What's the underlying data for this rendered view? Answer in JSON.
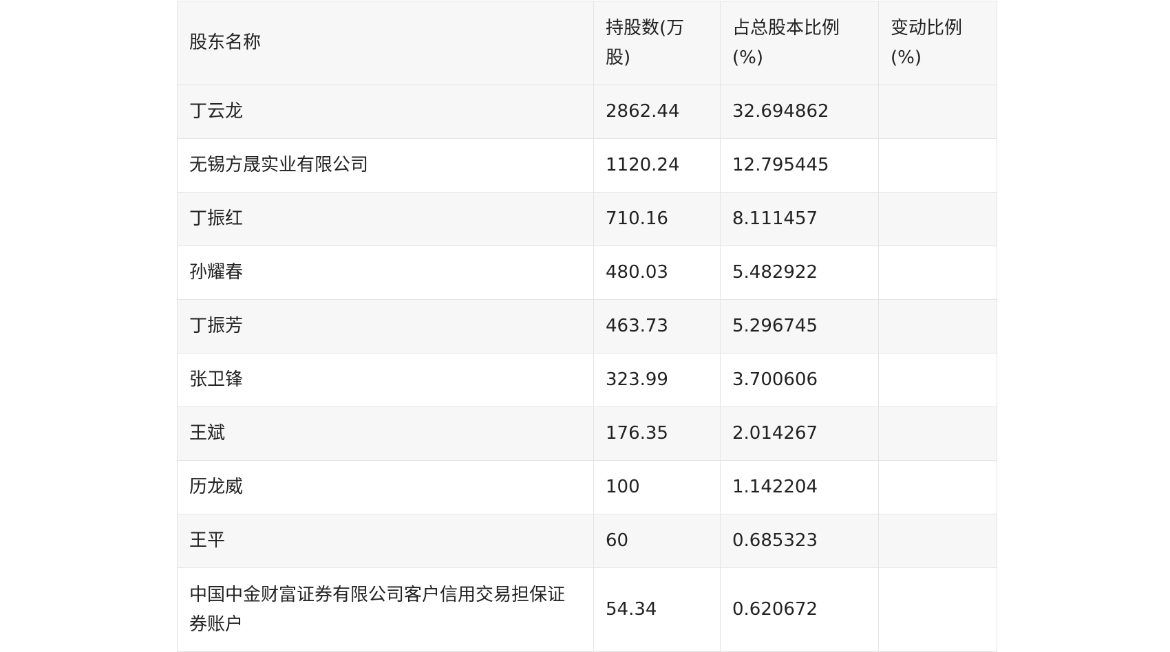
{
  "table": {
    "headers": [
      "股东名称",
      "持股数(万股)",
      "占总股本比例(%)",
      "变动比例(%)"
    ],
    "rows": [
      {
        "name": "丁云龙",
        "shares": "2862.44",
        "ratio": "32.694862",
        "change": ""
      },
      {
        "name": "无锡方晟实业有限公司",
        "shares": "1120.24",
        "ratio": "12.795445",
        "change": ""
      },
      {
        "name": "丁振红",
        "shares": "710.16",
        "ratio": "8.111457",
        "change": ""
      },
      {
        "name": "孙耀春",
        "shares": "480.03",
        "ratio": "5.482922",
        "change": ""
      },
      {
        "name": "丁振芳",
        "shares": "463.73",
        "ratio": "5.296745",
        "change": ""
      },
      {
        "name": "张卫锋",
        "shares": "323.99",
        "ratio": "3.700606",
        "change": ""
      },
      {
        "name": "王斌",
        "shares": "176.35",
        "ratio": "2.014267",
        "change": ""
      },
      {
        "name": "历龙威",
        "shares": "100",
        "ratio": "1.142204",
        "change": ""
      },
      {
        "name": "王平",
        "shares": "60",
        "ratio": "0.685323",
        "change": ""
      },
      {
        "name": "中国中金财富证券有限公司客户信用交易担保证券账户",
        "shares": "54.34",
        "ratio": "0.620672",
        "change": ""
      }
    ]
  }
}
